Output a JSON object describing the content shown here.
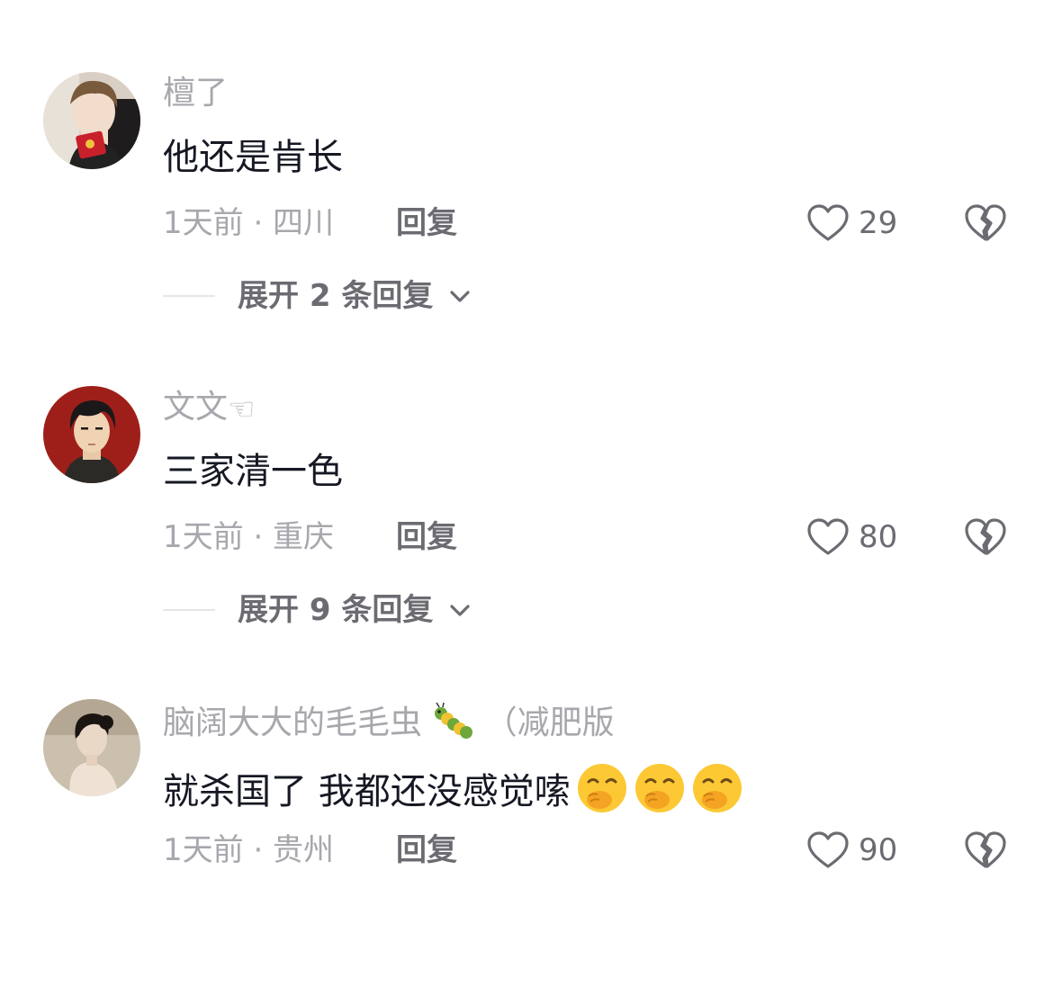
{
  "comments": [
    {
      "username": "檀了",
      "username_emoji": "",
      "text": "他还是肯长",
      "content_emojis": [],
      "time_location": "1天前 · 四川",
      "reply_label": "回复",
      "like_count": "29",
      "expand_label": "展开 2 条回复",
      "avatar_icon": "avatar-young-man-red-envelope"
    },
    {
      "username": "文文",
      "username_emoji": "🫳",
      "text": "三家清一色",
      "content_emojis": [],
      "time_location": "1天前 · 重庆",
      "reply_label": "回复",
      "like_count": "80",
      "expand_label": "展开 9 条回复",
      "avatar_icon": "avatar-illustrated-man"
    },
    {
      "username": "脑阔大大的毛毛虫",
      "username_emoji": "🐛",
      "username_suffix": "（减肥版",
      "text": "就杀国了  我都还没感觉嗦",
      "content_emojis": [
        "face-with-hand-over-mouth-emoji",
        "face-with-hand-over-mouth-emoji",
        "face-with-hand-over-mouth-emoji"
      ],
      "time_location": "1天前 · 贵州",
      "reply_label": "回复",
      "like_count": "90",
      "avatar_icon": "avatar-woman-portrait"
    }
  ],
  "colors": {
    "primary_text": "#161823",
    "secondary_text": "#a7a7ad",
    "action_text": "#6b6b72",
    "divider": "#e6e6ea",
    "background": "#ffffff"
  }
}
